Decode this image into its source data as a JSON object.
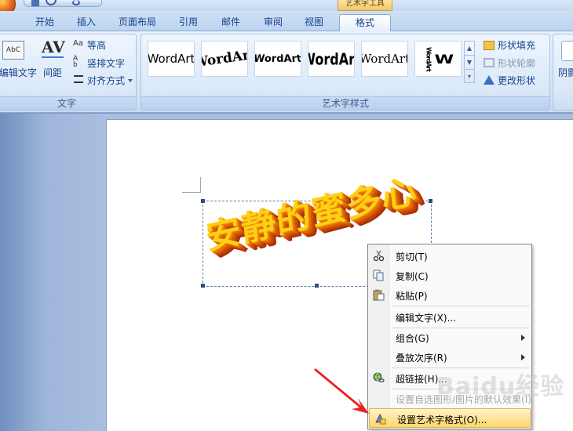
{
  "context_title": "艺术字工具",
  "tabs": [
    "开始",
    "插入",
    "页面布局",
    "引用",
    "邮件",
    "审阅",
    "视图",
    "格式"
  ],
  "active_tab": "格式",
  "ribbon": {
    "text_group": {
      "label": "文字",
      "edit_text": "编辑文字",
      "spacing": "间距",
      "spacing_icon_text": "AV",
      "equal_height": "等高",
      "vertical": "竖排文字",
      "align": "对齐方式"
    },
    "wordart_group": {
      "label": "艺术字样式",
      "gallery": [
        "WordArt",
        "WordArt",
        "WordArt",
        "WordArt",
        "WordArt",
        "WordArt",
        "W"
      ]
    },
    "shape_group": {
      "fill": "形状填充",
      "outline": "形状轮廓",
      "change": "更改形状"
    },
    "shadow_label": "阴影"
  },
  "document": {
    "wordart_text": "安静的蜜多心"
  },
  "context_menu": {
    "items": [
      {
        "label": "剪切(T)",
        "icon": "scissors-icon"
      },
      {
        "label": "复制(C)",
        "icon": "copy-icon"
      },
      {
        "label": "粘贴(P)",
        "icon": "paste-icon"
      },
      {
        "label": "编辑文字(X)..."
      },
      {
        "label": "组合(G)",
        "submenu": true
      },
      {
        "label": "叠放次序(R)",
        "submenu": true
      },
      {
        "label": "超链接(H)...",
        "icon": "hyperlink-icon"
      },
      {
        "label": "设置自选图形/图片的默认效果(I)",
        "disabled": true
      },
      {
        "label": "设置艺术字格式(O)...",
        "icon": "format-wordart-icon",
        "highlighted": true
      }
    ]
  },
  "watermark": "Baidu经验"
}
